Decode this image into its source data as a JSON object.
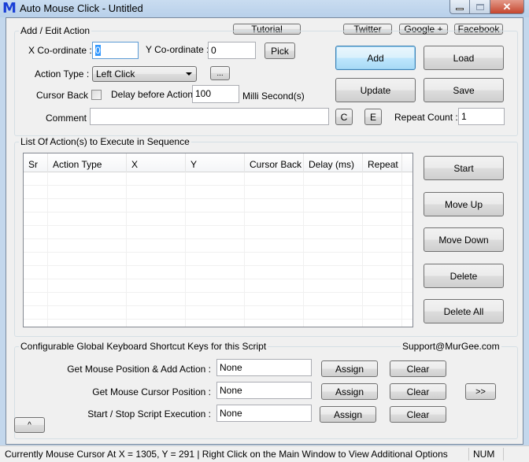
{
  "window": {
    "app_icon": "M",
    "title": "Auto Mouse Click - Untitled",
    "controls": {
      "minimize": "minimize-icon",
      "maximize": "maximize-icon",
      "close": "✕"
    }
  },
  "top_links": {
    "tutorial": "Tutorial",
    "twitter": "Twitter",
    "google": "Google +",
    "facebook": "Facebook"
  },
  "add_edit": {
    "group_title": "Add / Edit Action",
    "x_label": "X Co-ordinate :",
    "x_value": "0",
    "y_label": "Y Co-ordinate :",
    "y_value": "0",
    "pick_label": "Pick",
    "action_type_label": "Action Type :",
    "action_type_value": "Left Click",
    "more_label": "...",
    "cursor_back_label": "Cursor Back :",
    "cursor_back_checked": false,
    "delay_label": "Delay before Action :",
    "delay_value": "100",
    "delay_unit": "Milli Second(s)",
    "comment_label": "Comment :",
    "comment_value": "",
    "c_label": "C",
    "e_label": "E",
    "repeat_label": "Repeat Count :",
    "repeat_value": "1"
  },
  "action_buttons": {
    "add": "Add",
    "load": "Load",
    "update": "Update",
    "save": "Save"
  },
  "list": {
    "group_title": "List Of Action(s) to Execute in Sequence",
    "columns": [
      "Sr",
      "Action Type",
      "X",
      "Y",
      "Cursor Back",
      "Delay (ms)",
      "Repeat"
    ],
    "rows": []
  },
  "list_buttons": {
    "start": "Start",
    "move_up": "Move Up",
    "move_down": "Move Down",
    "delete": "Delete",
    "delete_all": "Delete All"
  },
  "shortcuts": {
    "group_title": "Configurable Global Keyboard Shortcut Keys for this Script",
    "support_email": "Support@MurGee.com",
    "items": [
      {
        "label": "Get Mouse Position & Add Action :",
        "value": "None",
        "assign": "Assign",
        "clear": "Clear"
      },
      {
        "label": "Get Mouse Cursor Position :",
        "value": "None",
        "assign": "Assign",
        "clear": "Clear"
      },
      {
        "label": "Start / Stop Script Execution :",
        "value": "None",
        "assign": "Assign",
        "clear": "Clear"
      }
    ],
    "expand_label": ">>",
    "collapse_label": "^"
  },
  "statusbar": {
    "text": "Currently Mouse Cursor At X = 1305, Y = 291 | Right Click on the Main Window to View Additional Options",
    "num_indicator": "NUM"
  }
}
